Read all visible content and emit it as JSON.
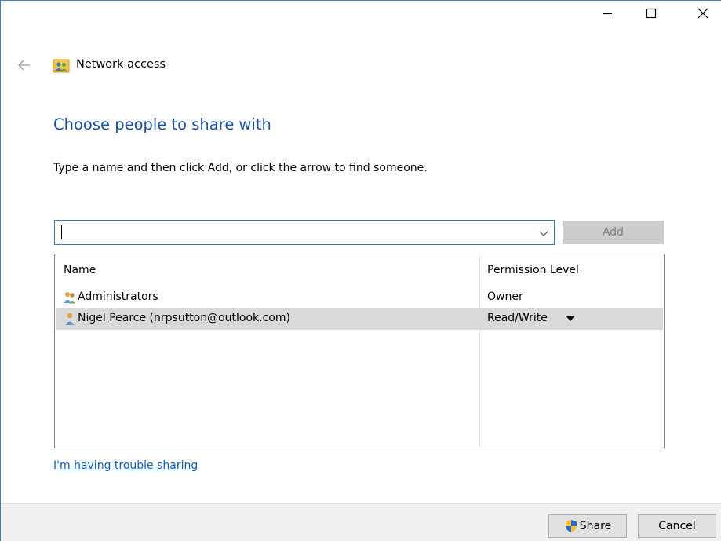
{
  "window": {
    "title": "Network access",
    "controls": {
      "minimize": "minimize-icon",
      "maximize": "maximize-icon",
      "close": "close-icon"
    }
  },
  "heading": "Choose people to share with",
  "instructions": "Type a name and then click Add, or click the arrow to find someone.",
  "input": {
    "value": "",
    "placeholder": ""
  },
  "add_label": "Add",
  "list": {
    "columns": {
      "name": "Name",
      "permission": "Permission Level"
    },
    "rows": [
      {
        "name": "Administrators",
        "permission": "Owner",
        "icon": "group-icon",
        "selected": false
      },
      {
        "name": "Nigel Pearce (nrpsutton@outlook.com)",
        "permission": "Read/Write",
        "icon": "user-icon",
        "selected": true
      }
    ]
  },
  "trouble_link": "I'm having trouble sharing",
  "footer": {
    "share_label": "Share",
    "cancel_label": "Cancel"
  },
  "colors": {
    "heading": "#1a4fa5",
    "link": "#0a60c2",
    "accent_border": "#2e76c3",
    "selected_row": "#d9d9d9"
  }
}
